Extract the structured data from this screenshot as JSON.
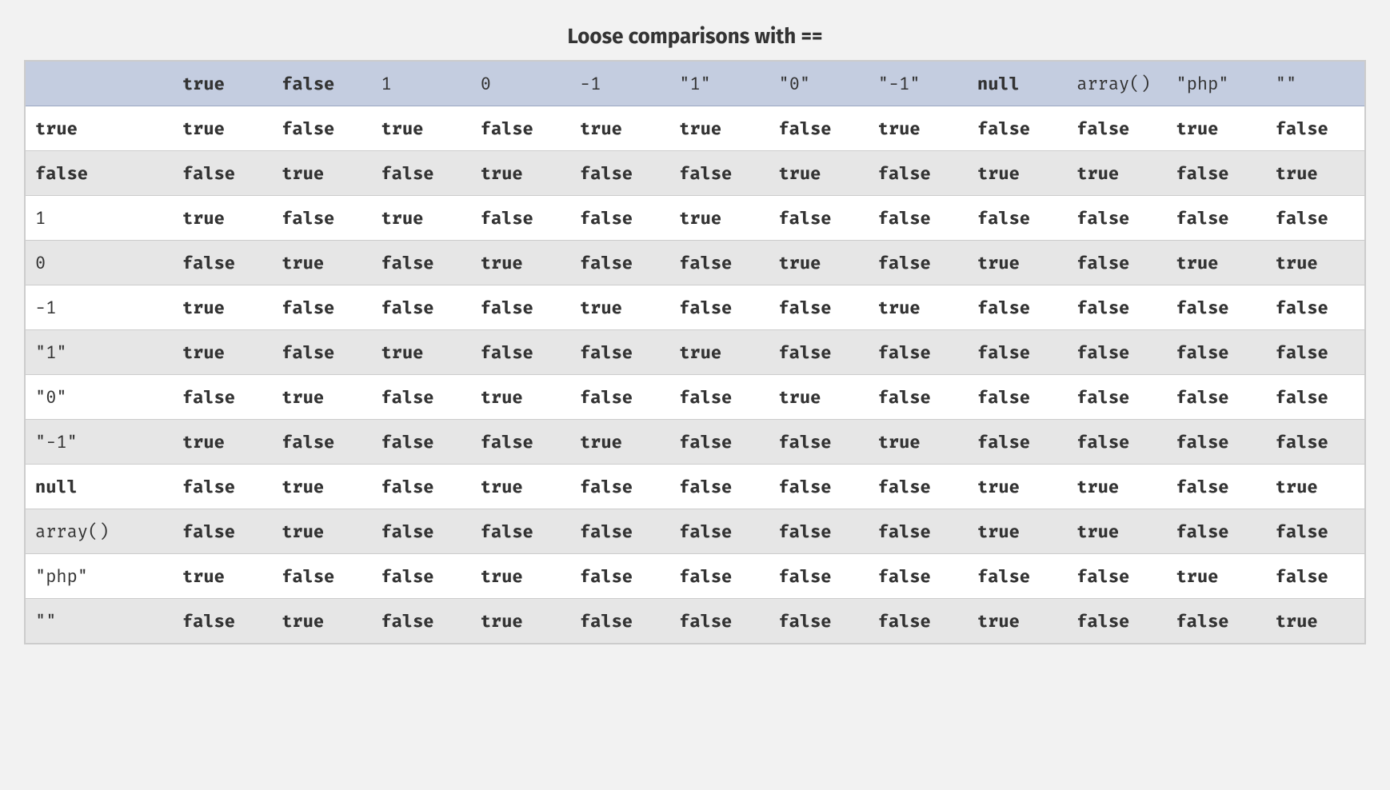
{
  "caption": "Loose comparisons with ==",
  "columns": [
    {
      "label": "true",
      "bold": true
    },
    {
      "label": "false",
      "bold": true
    },
    {
      "label": "1",
      "bold": false
    },
    {
      "label": "0",
      "bold": false
    },
    {
      "label": "-1",
      "bold": false
    },
    {
      "label": "\"1\"",
      "bold": false
    },
    {
      "label": "\"0\"",
      "bold": false
    },
    {
      "label": "\"-1\"",
      "bold": false
    },
    {
      "label": "null",
      "bold": true
    },
    {
      "label": "array()",
      "bold": false
    },
    {
      "label": "\"php\"",
      "bold": false
    },
    {
      "label": "\"\"",
      "bold": false
    }
  ],
  "rows": [
    {
      "label": "true",
      "bold": true,
      "cells": [
        "true",
        "false",
        "true",
        "false",
        "true",
        "true",
        "false",
        "true",
        "false",
        "false",
        "true",
        "false"
      ]
    },
    {
      "label": "false",
      "bold": true,
      "cells": [
        "false",
        "true",
        "false",
        "true",
        "false",
        "false",
        "true",
        "false",
        "true",
        "true",
        "false",
        "true"
      ]
    },
    {
      "label": "1",
      "bold": false,
      "cells": [
        "true",
        "false",
        "true",
        "false",
        "false",
        "true",
        "false",
        "false",
        "false",
        "false",
        "false",
        "false"
      ]
    },
    {
      "label": "0",
      "bold": false,
      "cells": [
        "false",
        "true",
        "false",
        "true",
        "false",
        "false",
        "true",
        "false",
        "true",
        "false",
        "true",
        "true"
      ]
    },
    {
      "label": "-1",
      "bold": false,
      "cells": [
        "true",
        "false",
        "false",
        "false",
        "true",
        "false",
        "false",
        "true",
        "false",
        "false",
        "false",
        "false"
      ]
    },
    {
      "label": "\"1\"",
      "bold": false,
      "cells": [
        "true",
        "false",
        "true",
        "false",
        "false",
        "true",
        "false",
        "false",
        "false",
        "false",
        "false",
        "false"
      ]
    },
    {
      "label": "\"0\"",
      "bold": false,
      "cells": [
        "false",
        "true",
        "false",
        "true",
        "false",
        "false",
        "true",
        "false",
        "false",
        "false",
        "false",
        "false"
      ]
    },
    {
      "label": "\"-1\"",
      "bold": false,
      "cells": [
        "true",
        "false",
        "false",
        "false",
        "true",
        "false",
        "false",
        "true",
        "false",
        "false",
        "false",
        "false"
      ]
    },
    {
      "label": "null",
      "bold": true,
      "cells": [
        "false",
        "true",
        "false",
        "true",
        "false",
        "false",
        "false",
        "false",
        "true",
        "true",
        "false",
        "true"
      ]
    },
    {
      "label": "array()",
      "bold": false,
      "cells": [
        "false",
        "true",
        "false",
        "false",
        "false",
        "false",
        "false",
        "false",
        "true",
        "true",
        "false",
        "false"
      ]
    },
    {
      "label": "\"php\"",
      "bold": false,
      "cells": [
        "true",
        "false",
        "false",
        "true",
        "false",
        "false",
        "false",
        "false",
        "false",
        "false",
        "true",
        "false"
      ]
    },
    {
      "label": "\"\"",
      "bold": false,
      "cells": [
        "false",
        "true",
        "false",
        "true",
        "false",
        "false",
        "false",
        "false",
        "true",
        "false",
        "false",
        "true"
      ]
    }
  ]
}
